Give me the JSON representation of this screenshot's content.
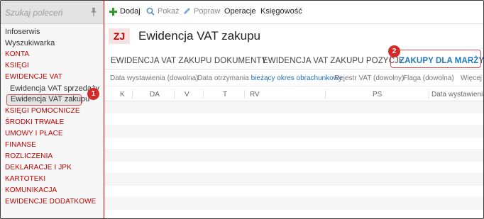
{
  "sidebar": {
    "search_placeholder": "Szukaj poleceń",
    "items": [
      {
        "label": "Infoserwis"
      },
      {
        "label": "Wyszukiwarka"
      },
      {
        "label": "KONTA"
      },
      {
        "label": "KSIĘGI"
      },
      {
        "label": "EWIDENCJE VAT"
      },
      {
        "label": "Ewidencja VAT sprzedaży"
      },
      {
        "label": "Ewidencja VAT zakupu"
      },
      {
        "label": "KSIĘGI POMOCNICZE"
      },
      {
        "label": "ŚRODKI TRWAŁE"
      },
      {
        "label": "UMOWY I PŁACE"
      },
      {
        "label": "FINANSE"
      },
      {
        "label": "ROZLICZENIA"
      },
      {
        "label": "DEKLARACJE I JPK"
      },
      {
        "label": "KARTOTEKI"
      },
      {
        "label": "KOMUNIKACJA"
      },
      {
        "label": "EWIDENCJE DODATKOWE"
      }
    ]
  },
  "toolbar": {
    "add": "Dodaj",
    "show": "Pokaż",
    "edit": "Popraw",
    "operations": "Operacje",
    "accounting": "Księgowość"
  },
  "page": {
    "badge": "ZJ",
    "title": "Ewidencja VAT zakupu"
  },
  "tabs": [
    {
      "label": "EWIDENCJA VAT ZAKUPU DOKUMENTY"
    },
    {
      "label": "EWIDENCJA VAT ZAKUPU POZYCJE"
    },
    {
      "label": "ZAKUPY DLA MARŻY"
    }
  ],
  "filters": {
    "date_issued": "Data wystawienia (dowolna)",
    "date_received": "Data otrzymania",
    "date_received_value": "bieżący okres obrachunkowy",
    "register": "Rejestr VAT (dowolny)",
    "flag": "Flaga (dowolna)",
    "more": "Więcej"
  },
  "columns": [
    "K",
    "DA",
    "V",
    "T",
    "RV",
    "PS",
    "Data wystawienia"
  ],
  "annotations": [
    "1",
    "2"
  ],
  "colors": {
    "brand_red": "#c00000",
    "active_tab_blue": "#1f7ab8",
    "add_green": "#2c9a2c",
    "annotation_red": "#d42a2a"
  }
}
